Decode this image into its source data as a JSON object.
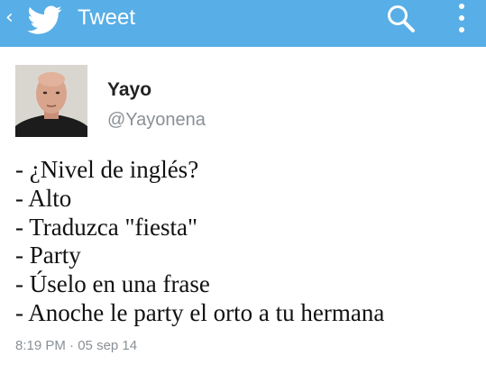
{
  "header": {
    "back_icon": "chevron-left-icon",
    "back_glyph": "‹",
    "logo_icon": "twitter-bird-icon",
    "title": "Tweet",
    "search_icon": "search-icon",
    "menu_icon": "more-vertical-icon",
    "background_color": "#58aee6"
  },
  "tweet": {
    "author": {
      "display_name": "Yayo",
      "handle": "@Yayonena"
    },
    "lines": [
      "- ¿Nivel de inglés?",
      "- Alto",
      "- Traduzca \"fiesta\"",
      "- Party",
      "- Úselo en una frase",
      "- Anoche le party el orto a tu hermana"
    ],
    "time": "8:19 PM",
    "separator": "·",
    "date": "05 sep 14"
  }
}
